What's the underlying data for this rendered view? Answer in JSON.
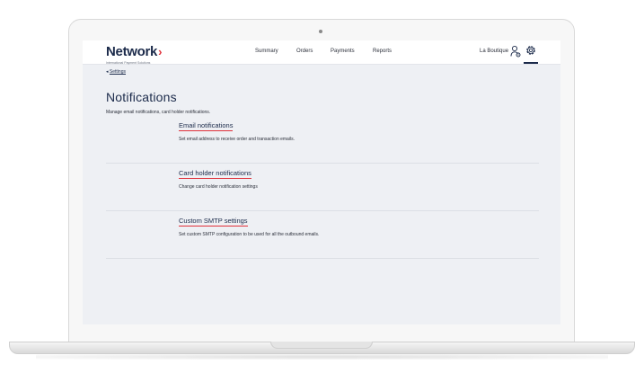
{
  "header": {
    "logo": {
      "name": "Network",
      "tagline": "International Payment Solutions"
    },
    "nav": [
      "Summary",
      "Orders",
      "Payments",
      "Reports"
    ],
    "merchant": "La Boutique"
  },
  "breadcrumb": {
    "back_label": "Settings"
  },
  "page": {
    "title": "Notifications",
    "description": "Manage email notifications, card holder notifications."
  },
  "sections": [
    {
      "title": "Email notifications",
      "description": "Set email address to receive order and transaction emails."
    },
    {
      "title": "Card holder notifications",
      "description": "Change card holder notification settings"
    },
    {
      "title": "Custom SMTP settings",
      "description": "Set custom SMTP configuration to be used for all the outbound emails."
    }
  ],
  "colors": {
    "brand_navy": "#1b2a4a",
    "accent_red": "#e0303a",
    "background": "#eef0f4"
  }
}
